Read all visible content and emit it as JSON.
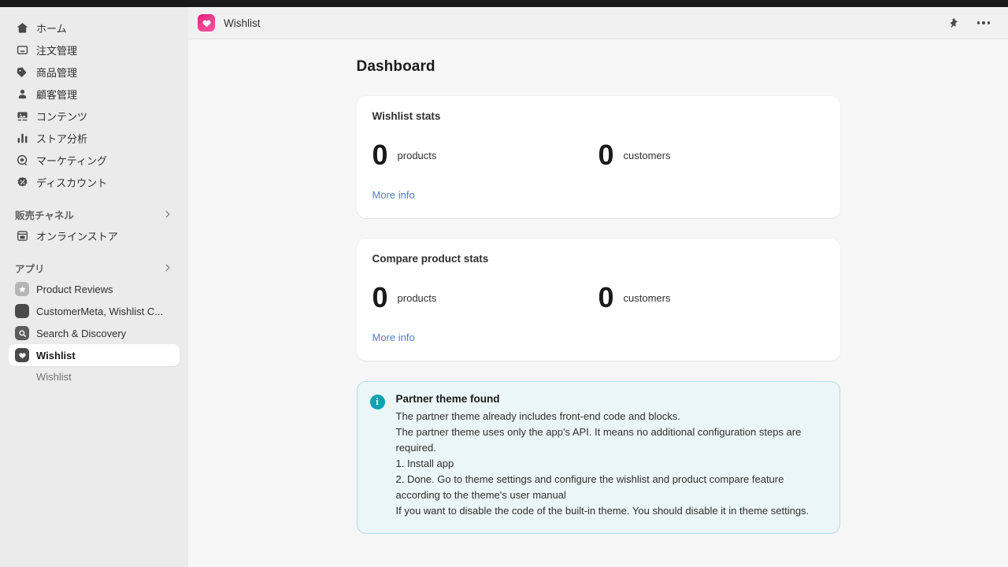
{
  "window": {
    "top_strip_color": "#1a1a1a"
  },
  "appbar": {
    "app_name": "Wishlist",
    "app_icon": "heart-icon",
    "pin_icon": "pin-icon",
    "more_icon": "more-horizontal-icon"
  },
  "sidebar": {
    "main_items": [
      {
        "label": "ホーム",
        "icon": "home-icon"
      },
      {
        "label": "注文管理",
        "icon": "orders-inbox-icon"
      },
      {
        "label": "商品管理",
        "icon": "product-tag-icon"
      },
      {
        "label": "顧客管理",
        "icon": "customer-person-icon"
      },
      {
        "label": "コンテンツ",
        "icon": "content-media-icon"
      },
      {
        "label": "ストア分析",
        "icon": "analytics-bar-chart-icon"
      },
      {
        "label": "マーケティング",
        "icon": "marketing-target-icon"
      },
      {
        "label": "ディスカウント",
        "icon": "discount-badge-icon"
      }
    ],
    "sales_channels": {
      "title": "販売チャネル",
      "chevron": "chevron-right-icon",
      "items": [
        {
          "label": "オンラインストア",
          "icon": "online-store-icon"
        }
      ]
    },
    "apps": {
      "title": "アプリ",
      "chevron": "chevron-right-icon",
      "items": [
        {
          "label": "Product Reviews",
          "icon": "star-app-icon",
          "selected": false
        },
        {
          "label": "CustomerMeta, Wishlist C...",
          "icon": "square-app-icon",
          "selected": false
        },
        {
          "label": "Search & Discovery",
          "icon": "search-app-icon",
          "selected": false
        },
        {
          "label": "Wishlist",
          "icon": "heart-app-icon",
          "selected": true
        }
      ],
      "sub_items": [
        {
          "label": "Wishlist"
        }
      ]
    }
  },
  "main": {
    "page_title": "Dashboard",
    "cards": [
      {
        "title": "Wishlist stats",
        "stats": [
          {
            "value": "0",
            "unit": "products"
          },
          {
            "value": "0",
            "unit": "customers"
          }
        ],
        "link": "More info"
      },
      {
        "title": "Compare product stats",
        "stats": [
          {
            "value": "0",
            "unit": "products"
          },
          {
            "value": "0",
            "unit": "customers"
          }
        ],
        "link": "More info"
      }
    ],
    "banner": {
      "icon": "info-icon",
      "title": "Partner theme found",
      "lines": [
        "The partner theme already includes front-end code and blocks.",
        "The partner theme uses only the app's API. It means no additional configuration steps are required.",
        "1. Install app",
        "2. Done. Go to theme settings and configure the wishlist and product compare feature according to the theme's user manual",
        "If you want to disable the code of the built-in theme. You should disable it in theme settings."
      ]
    }
  },
  "colors": {
    "accent_pink": "#e8197d",
    "link_blue": "#4f7ec9",
    "info_teal": "#12a0b3",
    "banner_bg": "#eaf6f8",
    "sidebar_bg": "#ebebeb",
    "content_bg": "#f6f6f7"
  }
}
